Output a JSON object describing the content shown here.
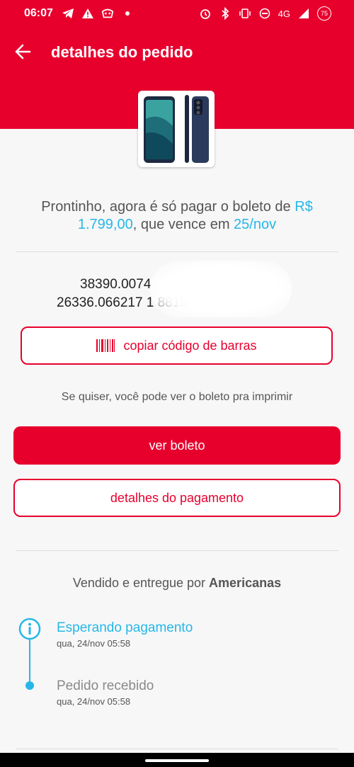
{
  "status_bar": {
    "time": "06:07",
    "network": "4G",
    "battery": "75",
    "left_icons": [
      "telegram-icon",
      "warning-icon",
      "app-icon",
      "dot-icon"
    ],
    "right_icons": [
      "alarm-icon",
      "bluetooth-icon",
      "vibrate-icon",
      "dnd-icon",
      "signal-icon",
      "battery-icon"
    ]
  },
  "header": {
    "title": "detalhes do pedido",
    "back_icon": "arrow-left-icon"
  },
  "payment": {
    "message_prefix": "Prontinho, agora é só pagar o boleto de ",
    "amount": "R$ 1.799,00",
    "message_middle": ", que vence em ",
    "due_date": "25/nov",
    "barcode_line1": "38390.0074",
    "barcode_line2": "26336.066217  1  8815",
    "copy_button": "copiar código de barras",
    "hint": "Se quiser, você pode ver o boleto pra imprimir",
    "view_button": "ver boleto",
    "details_button": "detalhes do pagamento"
  },
  "seller": {
    "prefix": "Vendido e entregue por ",
    "name": "Americanas"
  },
  "timeline": [
    {
      "title": "Esperando pagamento",
      "date": "qua, 24/nov 05:58",
      "color": "#26b7e8"
    },
    {
      "title": "Pedido recebido",
      "date": "qua, 24/nov 05:58",
      "color": "#8a8a8a"
    }
  ],
  "colors": {
    "brand": "#e8002d",
    "accent": "#26b7e8"
  }
}
